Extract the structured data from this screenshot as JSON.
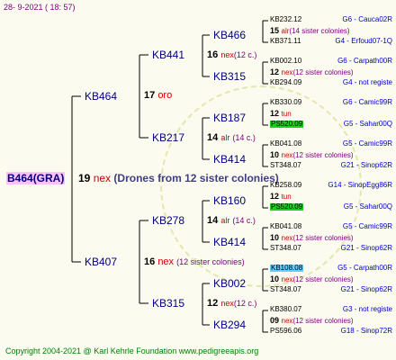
{
  "date": "28-  9-2021 ( 18: 57)",
  "copyright": "Copyright 2004-2021 @ Karl Kehrle Foundation   www.pedigreeapis.org",
  "root": {
    "name": "B464(GRA)",
    "num": "19",
    "mark": "nex",
    "desc": "(Drones from 12 sister colonies)"
  },
  "g1": [
    {
      "name": "KB464",
      "num": "17",
      "mark": "oro",
      "sc": ""
    },
    {
      "name": "KB407",
      "num": "16",
      "mark": "nex",
      "sc": "(12 sister colonies)"
    }
  ],
  "g2": [
    {
      "name": "KB441",
      "num": "16",
      "mark": "nex",
      "sc": "(12 c.)"
    },
    {
      "name": "KB217",
      "num": "14",
      "mark": "alr",
      "sc": "(14 c.)"
    },
    {
      "name": "KB278",
      "num": "14",
      "mark": "alr",
      "sc": "(14 c.)"
    },
    {
      "name": "KB315",
      "num": "12",
      "mark": "nex",
      "sc": "(12 c.)"
    }
  ],
  "g3": [
    {
      "name": "KB466"
    },
    {
      "name": "KB315"
    },
    {
      "name": "KB187"
    },
    {
      "name": "KB414"
    },
    {
      "name": "KB160"
    },
    {
      "name": "KB414"
    },
    {
      "name": "KB002"
    },
    {
      "name": "KB294"
    }
  ],
  "g4": [
    {
      "a": "KB232.12",
      "b": "G6 - Cauca02R",
      "num": "15",
      "mark": "alr",
      "sc": "(14 sister colonies)",
      "c": "KB371.11",
      "d": "G4 - Erfoud07-1Q"
    },
    {
      "a": "KB002.10",
      "b": "G6 - Carpath00R",
      "num": "12",
      "mark": "nex",
      "sc": "(12 sister colonies)",
      "c": "KB294.09",
      "d": "G4 - not registe"
    },
    {
      "a": "KB330.09",
      "b": "G6 - Camic99R",
      "num": "12",
      "mark": "tun",
      "sc": "",
      "c": "PS520.09",
      "d": "G5 - Sahar00Q",
      "chl": "green"
    },
    {
      "a": "KB041.08",
      "b": "G5 - Camic99R",
      "num": "10",
      "mark": "nex",
      "sc": "(12 sister colonies)",
      "c": "ST348.07",
      "d": "G21 - Sinop62R"
    },
    {
      "a": "KB258.09",
      "b": "G14 - SinopEgg86R",
      "num": "12",
      "mark": "tun",
      "sc": "",
      "c": "PS520.09",
      "d": "G5 - Sahar00Q",
      "chl": "green"
    },
    {
      "a": "KB041.08",
      "b": "G5 - Camic99R",
      "num": "10",
      "mark": "nex",
      "sc": "(12 sister colonies)",
      "c": "ST348.07",
      "d": "G21 - Sinop62R"
    },
    {
      "a": "KB108.08",
      "b": "G5 - Carpath00R",
      "num": "10",
      "mark": "nex",
      "sc": "(12 sister colonies)",
      "c": "ST348.07",
      "d": "G21 - Sinop62R",
      "ahl": "cyan"
    },
    {
      "a": "KB380.07",
      "b": "G3 - not registe",
      "num": "09",
      "mark": "nex",
      "sc": "(12 sister colonies)",
      "c": "PS596.06",
      "d": "G18 - Sinop72R"
    }
  ]
}
